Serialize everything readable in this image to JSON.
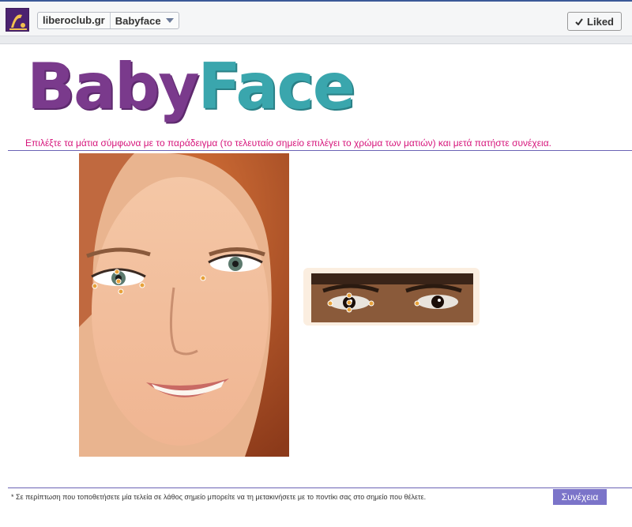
{
  "header": {
    "site_name": "liberoclub.gr",
    "app_name": "Babyface",
    "liked_label": "Liked",
    "liked_icon": "checkmark-icon",
    "thumb_icon": "page-thumbnail"
  },
  "logo": {
    "part1": "Baby",
    "part2": "Face",
    "color1": "#7a3a8c",
    "color2": "#3aa6ad"
  },
  "instruction": "Επιλέξτε τα μάτια σύμφωνα με το παράδειγμα (το τελευταίο σημείο επιλέγει το χρώμα των ματιών) και μετά πατήστε συνέχεια.",
  "footnote": "* Σε περίπτωση που τοποθετήσετε μία τελεία σε λάθος σημείο μπορείτε να τη μετακινήσετε με το ποντίκι σας στο σημείο που θέλετε.",
  "continue_label": "Συνέχεια",
  "colors": {
    "instruction": "#d6157b",
    "divider": "#6b63b5",
    "button": "#7b74c9",
    "marker": "#e8a23a"
  }
}
